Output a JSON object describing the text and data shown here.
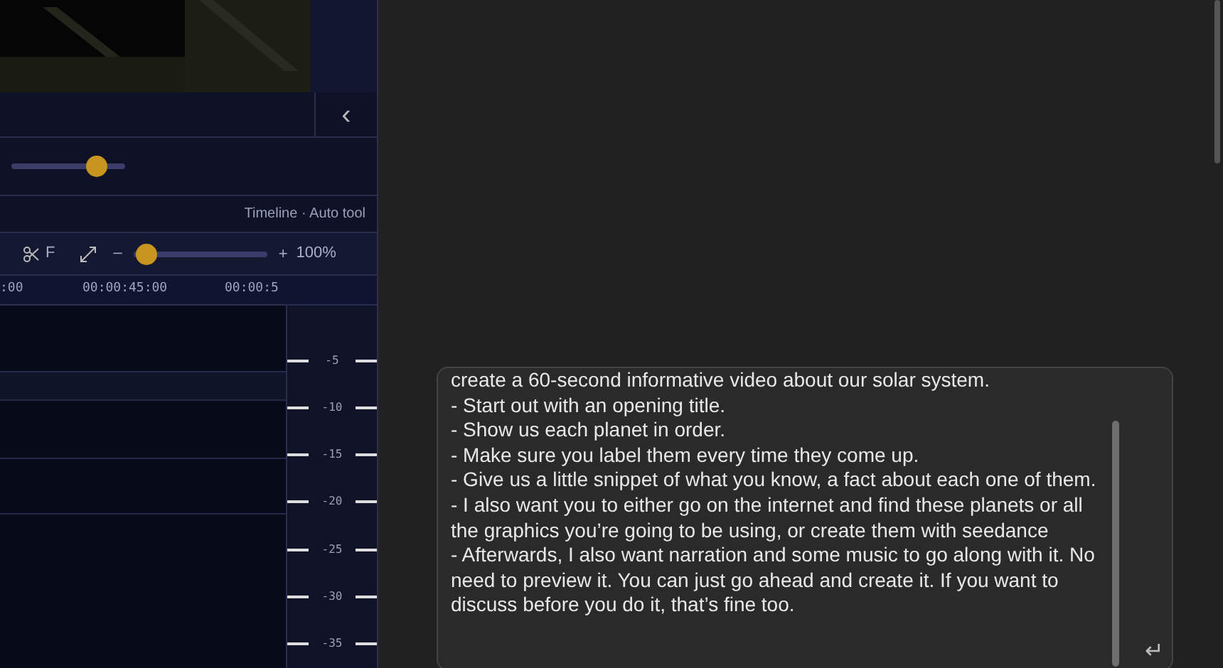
{
  "editor": {
    "preview_slider": {
      "level": 0.75
    },
    "collapse_button": {
      "label": "‹"
    },
    "mode_label": "Timeline · Auto tool",
    "toolbar": {
      "cut_label": "F",
      "zoom_out": "–",
      "zoom_in": "+",
      "zoom_slider": {
        "level": 0.1
      },
      "zoom_value": "100%"
    },
    "ruler": [
      ":00",
      "00:00:45:00",
      "00:00:5"
    ],
    "meter_scale": [
      "-5",
      "-10",
      "-15",
      "-20",
      "-25",
      "-30",
      "-35"
    ]
  },
  "chat": {
    "message": {
      "value": "create a 60-second informative video about our solar system.\n- Start out with an opening title.\n- Show us each planet in order.\n- Make sure you label them every time they come up.\n- Give us a little snippet of what you know, a fact about each one of them.\n- I also want you to either go on the internet and find these planets or all the graphics you’re going to be using, or create them with seedance\n- Afterwards, I also want narration and some music to go along with it. No need to preview it. You can just go ahead and create it. If you want to discuss before you do it, that’s fine too."
    },
    "send_button": {
      "label": "↵"
    }
  }
}
